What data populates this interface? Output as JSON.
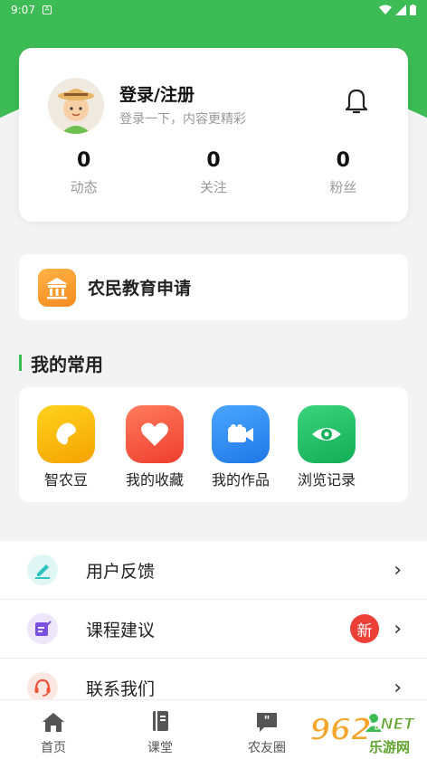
{
  "statusbar": {
    "time": "9:07",
    "notif_glyph": "A"
  },
  "profile": {
    "title": "登录/注册",
    "subtitle": "登录一下，内容更精彩",
    "stats": [
      {
        "value": "0",
        "label": "动态"
      },
      {
        "value": "0",
        "label": "关注"
      },
      {
        "value": "0",
        "label": "粉丝"
      }
    ]
  },
  "education": {
    "label": "农民教育申请"
  },
  "common": {
    "title": "我的常用",
    "items": [
      {
        "label": "智农豆",
        "icon": "bean-icon",
        "color": "#f7b500"
      },
      {
        "label": "我的收藏",
        "icon": "heart-icon",
        "color": "#f2553f"
      },
      {
        "label": "我的作品",
        "icon": "video-camera-icon",
        "color": "#2f8df0"
      },
      {
        "label": "浏览记录",
        "icon": "eye-icon",
        "color": "#26c06a"
      }
    ]
  },
  "menu": [
    {
      "label": "用户反馈",
      "icon": "pencil-icon",
      "badge": ""
    },
    {
      "label": "课程建议",
      "icon": "edit-note-icon",
      "badge": "新"
    },
    {
      "label": "联系我们",
      "icon": "headset-icon",
      "badge": ""
    }
  ],
  "tabs": [
    {
      "label": "首页",
      "icon": "home-icon"
    },
    {
      "label": "课堂",
      "icon": "book-icon"
    },
    {
      "label": "农友圈",
      "icon": "chat-quote-icon"
    },
    {
      "label": "",
      "icon": "profile-icon"
    }
  ],
  "watermark": {
    "num": "962",
    "net": ".NET",
    "cn": "乐游网"
  },
  "colors": {
    "brand_green": "#3dbb54",
    "badge_red": "#ec3f36"
  }
}
